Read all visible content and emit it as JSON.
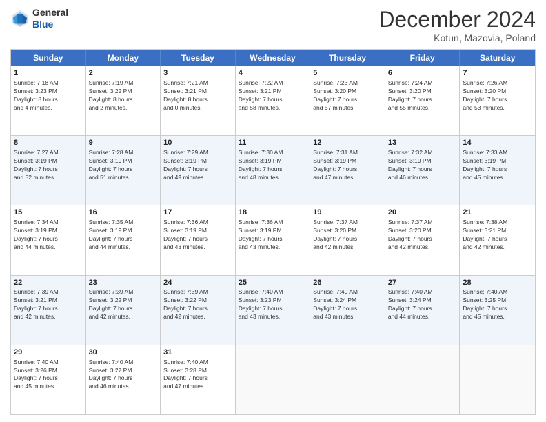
{
  "header": {
    "logo_general": "General",
    "logo_blue": "Blue",
    "month_title": "December 2024",
    "location": "Kotun, Mazovia, Poland"
  },
  "days": [
    "Sunday",
    "Monday",
    "Tuesday",
    "Wednesday",
    "Thursday",
    "Friday",
    "Saturday"
  ],
  "rows": [
    [
      {
        "day": "1",
        "lines": [
          "Sunrise: 7:18 AM",
          "Sunset: 3:23 PM",
          "Daylight: 8 hours",
          "and 4 minutes."
        ]
      },
      {
        "day": "2",
        "lines": [
          "Sunrise: 7:19 AM",
          "Sunset: 3:22 PM",
          "Daylight: 8 hours",
          "and 2 minutes."
        ]
      },
      {
        "day": "3",
        "lines": [
          "Sunrise: 7:21 AM",
          "Sunset: 3:21 PM",
          "Daylight: 8 hours",
          "and 0 minutes."
        ]
      },
      {
        "day": "4",
        "lines": [
          "Sunrise: 7:22 AM",
          "Sunset: 3:21 PM",
          "Daylight: 7 hours",
          "and 58 minutes."
        ]
      },
      {
        "day": "5",
        "lines": [
          "Sunrise: 7:23 AM",
          "Sunset: 3:20 PM",
          "Daylight: 7 hours",
          "and 57 minutes."
        ]
      },
      {
        "day": "6",
        "lines": [
          "Sunrise: 7:24 AM",
          "Sunset: 3:20 PM",
          "Daylight: 7 hours",
          "and 55 minutes."
        ]
      },
      {
        "day": "7",
        "lines": [
          "Sunrise: 7:26 AM",
          "Sunset: 3:20 PM",
          "Daylight: 7 hours",
          "and 53 minutes."
        ]
      }
    ],
    [
      {
        "day": "8",
        "lines": [
          "Sunrise: 7:27 AM",
          "Sunset: 3:19 PM",
          "Daylight: 7 hours",
          "and 52 minutes."
        ]
      },
      {
        "day": "9",
        "lines": [
          "Sunrise: 7:28 AM",
          "Sunset: 3:19 PM",
          "Daylight: 7 hours",
          "and 51 minutes."
        ]
      },
      {
        "day": "10",
        "lines": [
          "Sunrise: 7:29 AM",
          "Sunset: 3:19 PM",
          "Daylight: 7 hours",
          "and 49 minutes."
        ]
      },
      {
        "day": "11",
        "lines": [
          "Sunrise: 7:30 AM",
          "Sunset: 3:19 PM",
          "Daylight: 7 hours",
          "and 48 minutes."
        ]
      },
      {
        "day": "12",
        "lines": [
          "Sunrise: 7:31 AM",
          "Sunset: 3:19 PM",
          "Daylight: 7 hours",
          "and 47 minutes."
        ]
      },
      {
        "day": "13",
        "lines": [
          "Sunrise: 7:32 AM",
          "Sunset: 3:19 PM",
          "Daylight: 7 hours",
          "and 46 minutes."
        ]
      },
      {
        "day": "14",
        "lines": [
          "Sunrise: 7:33 AM",
          "Sunset: 3:19 PM",
          "Daylight: 7 hours",
          "and 45 minutes."
        ]
      }
    ],
    [
      {
        "day": "15",
        "lines": [
          "Sunrise: 7:34 AM",
          "Sunset: 3:19 PM",
          "Daylight: 7 hours",
          "and 44 minutes."
        ]
      },
      {
        "day": "16",
        "lines": [
          "Sunrise: 7:35 AM",
          "Sunset: 3:19 PM",
          "Daylight: 7 hours",
          "and 44 minutes."
        ]
      },
      {
        "day": "17",
        "lines": [
          "Sunrise: 7:36 AM",
          "Sunset: 3:19 PM",
          "Daylight: 7 hours",
          "and 43 minutes."
        ]
      },
      {
        "day": "18",
        "lines": [
          "Sunrise: 7:36 AM",
          "Sunset: 3:19 PM",
          "Daylight: 7 hours",
          "and 43 minutes."
        ]
      },
      {
        "day": "19",
        "lines": [
          "Sunrise: 7:37 AM",
          "Sunset: 3:20 PM",
          "Daylight: 7 hours",
          "and 42 minutes."
        ]
      },
      {
        "day": "20",
        "lines": [
          "Sunrise: 7:37 AM",
          "Sunset: 3:20 PM",
          "Daylight: 7 hours",
          "and 42 minutes."
        ]
      },
      {
        "day": "21",
        "lines": [
          "Sunrise: 7:38 AM",
          "Sunset: 3:21 PM",
          "Daylight: 7 hours",
          "and 42 minutes."
        ]
      }
    ],
    [
      {
        "day": "22",
        "lines": [
          "Sunrise: 7:39 AM",
          "Sunset: 3:21 PM",
          "Daylight: 7 hours",
          "and 42 minutes."
        ]
      },
      {
        "day": "23",
        "lines": [
          "Sunrise: 7:39 AM",
          "Sunset: 3:22 PM",
          "Daylight: 7 hours",
          "and 42 minutes."
        ]
      },
      {
        "day": "24",
        "lines": [
          "Sunrise: 7:39 AM",
          "Sunset: 3:22 PM",
          "Daylight: 7 hours",
          "and 42 minutes."
        ]
      },
      {
        "day": "25",
        "lines": [
          "Sunrise: 7:40 AM",
          "Sunset: 3:23 PM",
          "Daylight: 7 hours",
          "and 43 minutes."
        ]
      },
      {
        "day": "26",
        "lines": [
          "Sunrise: 7:40 AM",
          "Sunset: 3:24 PM",
          "Daylight: 7 hours",
          "and 43 minutes."
        ]
      },
      {
        "day": "27",
        "lines": [
          "Sunrise: 7:40 AM",
          "Sunset: 3:24 PM",
          "Daylight: 7 hours",
          "and 44 minutes."
        ]
      },
      {
        "day": "28",
        "lines": [
          "Sunrise: 7:40 AM",
          "Sunset: 3:25 PM",
          "Daylight: 7 hours",
          "and 45 minutes."
        ]
      }
    ],
    [
      {
        "day": "29",
        "lines": [
          "Sunrise: 7:40 AM",
          "Sunset: 3:26 PM",
          "Daylight: 7 hours",
          "and 45 minutes."
        ]
      },
      {
        "day": "30",
        "lines": [
          "Sunrise: 7:40 AM",
          "Sunset: 3:27 PM",
          "Daylight: 7 hours",
          "and 46 minutes."
        ]
      },
      {
        "day": "31",
        "lines": [
          "Sunrise: 7:40 AM",
          "Sunset: 3:28 PM",
          "Daylight: 7 hours",
          "and 47 minutes."
        ]
      },
      {
        "day": "",
        "lines": []
      },
      {
        "day": "",
        "lines": []
      },
      {
        "day": "",
        "lines": []
      },
      {
        "day": "",
        "lines": []
      }
    ]
  ]
}
